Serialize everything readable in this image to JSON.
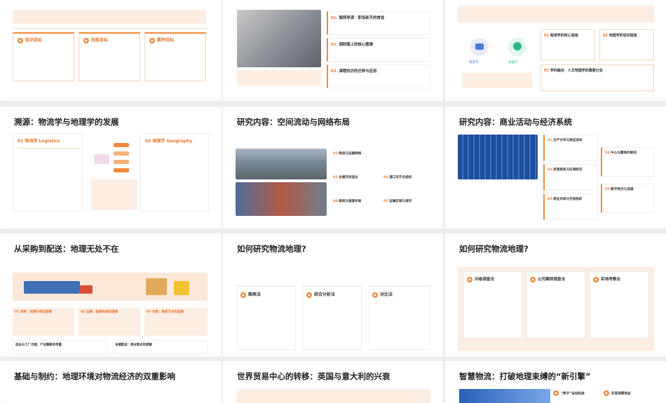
{
  "slides": {
    "s1": {
      "cards": [
        {
          "title": "知识目标"
        },
        {
          "title": "技能目标"
        },
        {
          "title": "素养目标"
        }
      ]
    },
    "s2": {
      "items": [
        {
          "num": "01.",
          "title": "案例导读：职场新手的首选"
        },
        {
          "num": "02.",
          "title": "调研路上的核心图谱"
        },
        {
          "num": "03.",
          "title": "课程知识的迁移与应用"
        }
      ]
    },
    "s3": {
      "left_label": "物流学",
      "right_label": "地理学",
      "items": [
        {
          "num": "01",
          "title": "物流学的核心视角"
        },
        {
          "num": "02",
          "title": "地理学的空间视角"
        },
        {
          "num": "03",
          "title": "学科融合：人文地理学的重要分支"
        }
      ]
    },
    "s4": {
      "title": "溯源：物流学与地理学的发展",
      "col1": "01  物流学  Logistics",
      "col2": "02  地理学  Geography"
    },
    "s5": {
      "title": "研究内容：空间流动与网络布局",
      "items": [
        {
          "num": "01.",
          "title": "物流与运输网络"
        },
        {
          "num": "02.",
          "title": "仓储空间选址"
        },
        {
          "num": "03.",
          "title": "港口及节点组织"
        },
        {
          "num": "04.",
          "title": "枢纽与通道布局"
        },
        {
          "num": "05.",
          "title": "运输区域与城市"
        },
        {
          "num": "",
          "title": ""
        }
      ]
    },
    "s6": {
      "title": "研究内容：商业活动与经济系统",
      "items": [
        {
          "num": "01.",
          "title": "生产分布与商品流动"
        },
        {
          "num": "02.",
          "title": "贸易联系与区域经济"
        },
        {
          "num": "03.",
          "title": "商业布局与空间组织"
        },
        {
          "num": "04.",
          "title": "中心与腹地的联动"
        },
        {
          "num": "05.",
          "title": "数字经济与流通"
        }
      ]
    },
    "s7": {
      "title": "从采购到配送：地理无处不在",
      "steps": [
        {
          "num": "01",
          "title": "采购：货源分布的逻辑"
        },
        {
          "num": "02",
          "title": "运输：路网布局的逻辑"
        },
        {
          "num": "03",
          "title": "仓储：枢纽节点的选择"
        }
      ],
      "bottom": [
        {
          "title": "选址与工厂仓储：产业集聚的考量"
        },
        {
          "title": "末端配送：商业网点的逻辑"
        }
      ]
    },
    "s8": {
      "title": "如何研究物流地理?",
      "cards": [
        {
          "title": "图表法"
        },
        {
          "title": "综合分析法"
        },
        {
          "title": "对比法"
        }
      ]
    },
    "s9": {
      "title": "如何研究物流地理?",
      "cards": [
        {
          "title": "问卷调查法"
        },
        {
          "title": "公司案例调查法"
        },
        {
          "title": "实地考察法"
        }
      ]
    },
    "s10": {
      "title": "基础与制约：地理环境对物流经济的双重影响"
    },
    "s11": {
      "title": "世界贸易中心的转移：英国与意大利的兴衰"
    },
    "s12": {
      "title": "智慧物流：打破地理束缚的“新引擎”",
      "chips": [
        "“数字”运动轨迹",
        "实现规模效益"
      ]
    }
  },
  "colors": {
    "accent": "#f08a3a",
    "peach": "#fdeee3",
    "background": "#ecedf0"
  }
}
